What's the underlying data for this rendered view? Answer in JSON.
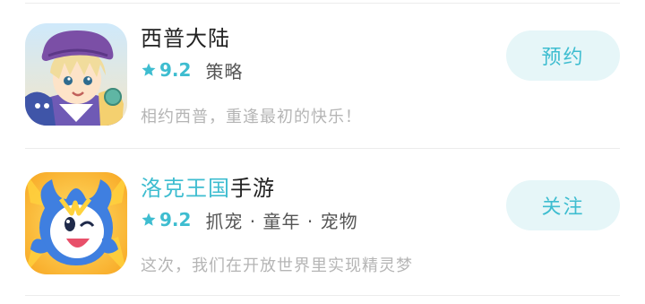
{
  "apps": [
    {
      "name": "西普大陆",
      "rating": "9.2",
      "tags": "策略",
      "description": "相约西普，重逢最初的快乐！",
      "action_label": "预约",
      "icon": "xipu-character-icon"
    },
    {
      "name_highlight": "洛克王国",
      "name_suffix": "手游",
      "rating": "9.2",
      "tags": "抓宠 · 童年 · 宠物",
      "description": "这次，我们在开放世界里实现精灵梦",
      "action_label": "关注",
      "icon": "roco-kingdom-character-icon"
    }
  ],
  "colors": {
    "accent": "#3ebdd0",
    "button_bg": "#e6f6f8",
    "title": "#222222",
    "tag": "#555555",
    "description": "#b5b5b5",
    "divider": "#ececec"
  }
}
